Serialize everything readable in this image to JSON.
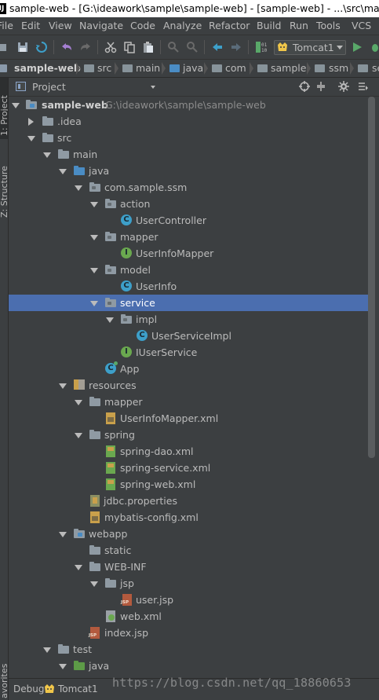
{
  "window": {
    "title": "sample-web - [G:\\ideawork\\sample\\sample-web] - [sample-web] - ...\\src\\main\\re"
  },
  "menu": [
    "File",
    "Edit",
    "View",
    "Navigate",
    "Code",
    "Analyze",
    "Refactor",
    "Build",
    "Run",
    "Tools",
    "VCS"
  ],
  "toolbar": {
    "run_config": "Tomcat1"
  },
  "breadcrumb": [
    "sample-web",
    "src",
    "main",
    "java",
    "com",
    "sample",
    "ssm",
    "se"
  ],
  "side_tabs": {
    "project": "1: Project",
    "structure": "Z: Structure",
    "favorites": "avorites"
  },
  "project_panel": {
    "title": "Project"
  },
  "tree": [
    {
      "label": "sample-web",
      "path": "G:\\ideawork\\sample\\sample-web",
      "icon": "module-folder-icon",
      "expanded": true
    },
    {
      "label": ".idea",
      "icon": "folder-icon",
      "expanded": false
    },
    {
      "label": "src",
      "icon": "folder-icon",
      "expanded": true
    },
    {
      "label": "main",
      "icon": "folder-icon",
      "expanded": true
    },
    {
      "label": "java",
      "icon": "source-folder-icon",
      "expanded": true
    },
    {
      "label": "com.sample.ssm",
      "icon": "package-icon",
      "expanded": true
    },
    {
      "label": "action",
      "icon": "package-icon",
      "expanded": true
    },
    {
      "label": "UserController",
      "icon": "class-icon"
    },
    {
      "label": "mapper",
      "icon": "package-icon",
      "expanded": true
    },
    {
      "label": "UserInfoMapper",
      "icon": "interface-icon"
    },
    {
      "label": "model",
      "icon": "package-icon",
      "expanded": true
    },
    {
      "label": "UserInfo",
      "icon": "class-icon"
    },
    {
      "label": "service",
      "icon": "package-icon",
      "expanded": true,
      "selected": true
    },
    {
      "label": "impl",
      "icon": "package-icon",
      "expanded": true
    },
    {
      "label": "UserServiceImpl",
      "icon": "class-icon"
    },
    {
      "label": "IUserService",
      "icon": "interface-icon"
    },
    {
      "label": "App",
      "icon": "spring-class-icon"
    },
    {
      "label": "resources",
      "icon": "resources-folder-icon",
      "expanded": true
    },
    {
      "label": "mapper",
      "icon": "folder-icon",
      "expanded": true
    },
    {
      "label": "UserInfoMapper.xml",
      "icon": "xml-file-icon"
    },
    {
      "label": "spring",
      "icon": "folder-icon",
      "expanded": true
    },
    {
      "label": "spring-dao.xml",
      "icon": "spring-xml-icon"
    },
    {
      "label": "spring-service.xml",
      "icon": "spring-xml-icon"
    },
    {
      "label": "spring-web.xml",
      "icon": "spring-xml-icon"
    },
    {
      "label": "jdbc.properties",
      "icon": "properties-file-icon"
    },
    {
      "label": "mybatis-config.xml",
      "icon": "xml-file-icon"
    },
    {
      "label": "webapp",
      "icon": "web-folder-icon",
      "expanded": true
    },
    {
      "label": "static",
      "icon": "folder-icon"
    },
    {
      "label": "WEB-INF",
      "icon": "folder-icon",
      "expanded": true
    },
    {
      "label": "jsp",
      "icon": "folder-icon",
      "expanded": true
    },
    {
      "label": "user.jsp",
      "icon": "jsp-file-icon"
    },
    {
      "label": "web.xml",
      "icon": "web-xml-icon"
    },
    {
      "label": "index.jsp",
      "icon": "jsp-file-icon"
    },
    {
      "label": "test",
      "icon": "folder-icon",
      "expanded": true
    },
    {
      "label": "java",
      "icon": "test-source-folder-icon",
      "expanded": true
    }
  ],
  "bottom": {
    "tool_label": "Debug",
    "config": "Tomcat1",
    "watermark": "https://blog.csdn.net/qq_18860653"
  },
  "colors": {
    "background": "#3c3f41",
    "selection": "#4b6eaf",
    "text": "#bbbbbb"
  }
}
